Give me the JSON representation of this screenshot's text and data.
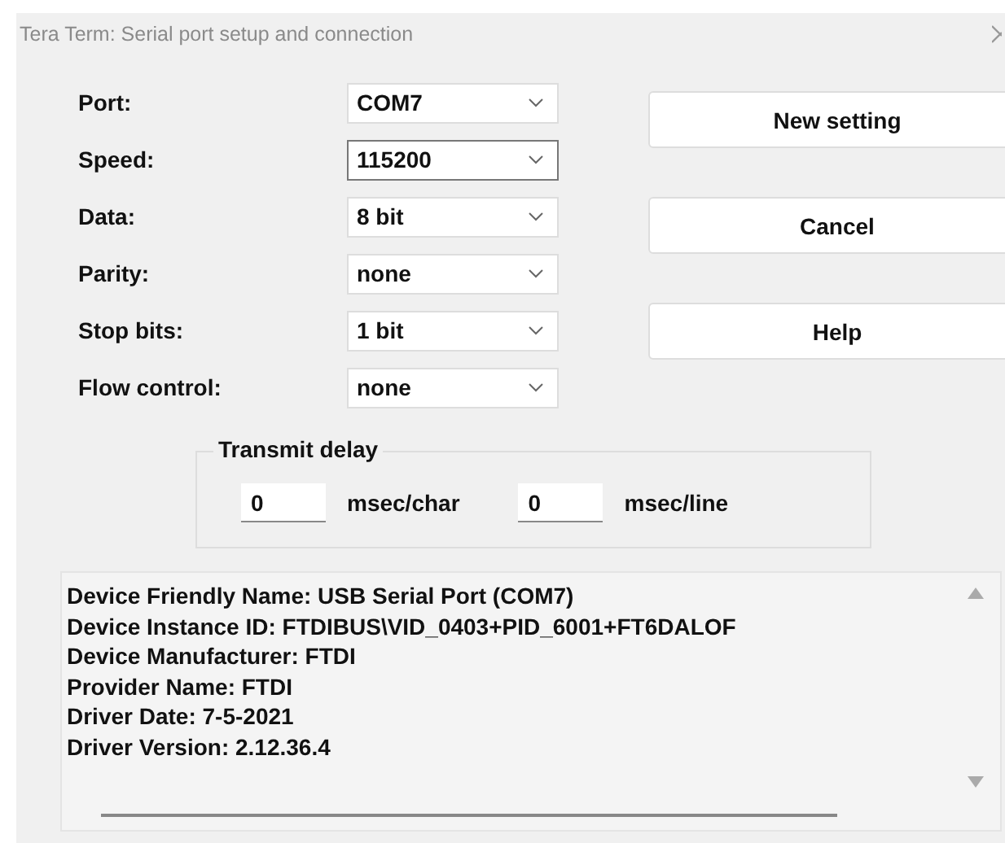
{
  "window": {
    "title": "Tera Term: Serial port setup and connection"
  },
  "fields": [
    {
      "label": "Port:",
      "value": "COM7",
      "focused": false
    },
    {
      "label": "Speed:",
      "value": "115200",
      "focused": true
    },
    {
      "label": "Data:",
      "value": "8 bit",
      "focused": false
    },
    {
      "label": "Parity:",
      "value": "none",
      "focused": false
    },
    {
      "label": "Stop bits:",
      "value": "1 bit",
      "focused": false
    },
    {
      "label": "Flow control:",
      "value": "none",
      "focused": false
    }
  ],
  "buttons": [
    "New setting",
    "Cancel",
    "Help"
  ],
  "transmit_delay": {
    "title": "Transmit delay",
    "char_value": "0",
    "char_unit": "msec/char",
    "line_value": "0",
    "line_unit": "msec/line"
  },
  "device_info": [
    "Device Friendly Name: USB Serial Port (COM7)",
    "Device Instance ID: FTDIBUS\\VID_0403+PID_6001+FT6DALOF",
    "Device Manufacturer: FTDI",
    "Provider Name: FTDI",
    "Driver Date: 7-5-2021",
    "Driver Version: 2.12.36.4"
  ]
}
